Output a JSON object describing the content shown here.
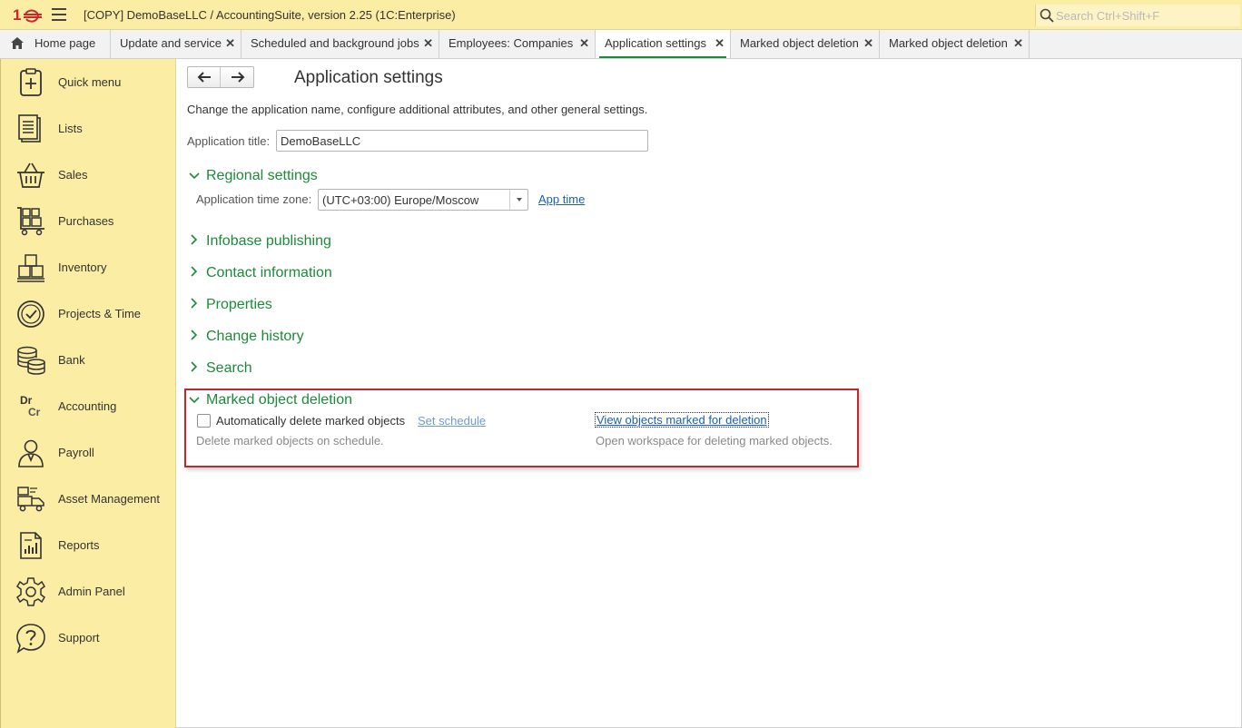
{
  "window": {
    "title": "[COPY] DemoBaseLLC / AccountingSuite, version 2.25  (1C:Enterprise)",
    "search_placeholder": "Search Ctrl+Shift+F"
  },
  "tabs": [
    {
      "label": "Home page"
    },
    {
      "label": "Update and service"
    },
    {
      "label": "Scheduled and background jobs"
    },
    {
      "label": "Employees: Companies"
    },
    {
      "label": "Application settings",
      "active": true
    },
    {
      "label": "Marked object deletion"
    },
    {
      "label": "Marked object deletion"
    }
  ],
  "sidebar": {
    "items": [
      {
        "label": "Quick menu",
        "icon": "quick-menu-icon"
      },
      {
        "label": "Lists",
        "icon": "lists-icon"
      },
      {
        "label": "Sales",
        "icon": "basket-icon"
      },
      {
        "label": "Purchases",
        "icon": "cart-icon"
      },
      {
        "label": "Inventory",
        "icon": "boxes-icon"
      },
      {
        "label": "Projects & Time",
        "icon": "clock-icon"
      },
      {
        "label": "Bank",
        "icon": "coins-icon"
      },
      {
        "label": "Accounting",
        "icon": "dr-cr-icon"
      },
      {
        "label": "Payroll",
        "icon": "person-icon"
      },
      {
        "label": "Asset Management",
        "icon": "truck-icon"
      },
      {
        "label": "Reports",
        "icon": "report-icon"
      },
      {
        "label": "Admin Panel",
        "icon": "gear-icon"
      },
      {
        "label": "Support",
        "icon": "question-icon"
      }
    ]
  },
  "main": {
    "title": "Application settings",
    "description": "Change the application name, configure additional attributes, and other general settings.",
    "app_title_label": "Application title:",
    "app_title_value": "DemoBaseLLC",
    "regional": {
      "header": "Regional settings",
      "tz_label": "Application time zone:",
      "tz_value": "(UTC+03:00) Europe/Moscow",
      "app_time_link": "App time"
    },
    "groups": [
      "Infobase publishing",
      "Contact information",
      "Properties",
      "Change history",
      "Search"
    ],
    "deletion": {
      "header": "Marked object deletion",
      "checkbox_label": "Automatically delete marked objects",
      "checkbox_checked": false,
      "set_schedule": "Set schedule",
      "view_link": "View objects marked for deletion",
      "hint_left": "Delete marked objects on schedule.",
      "hint_right": "Open workspace for deleting marked objects."
    }
  },
  "colors": {
    "accent_green": "#1c8a38",
    "sidebar_bg": "#fbeda3",
    "highlight_red": "#c4262e",
    "link_blue": "#1a5fb4"
  }
}
